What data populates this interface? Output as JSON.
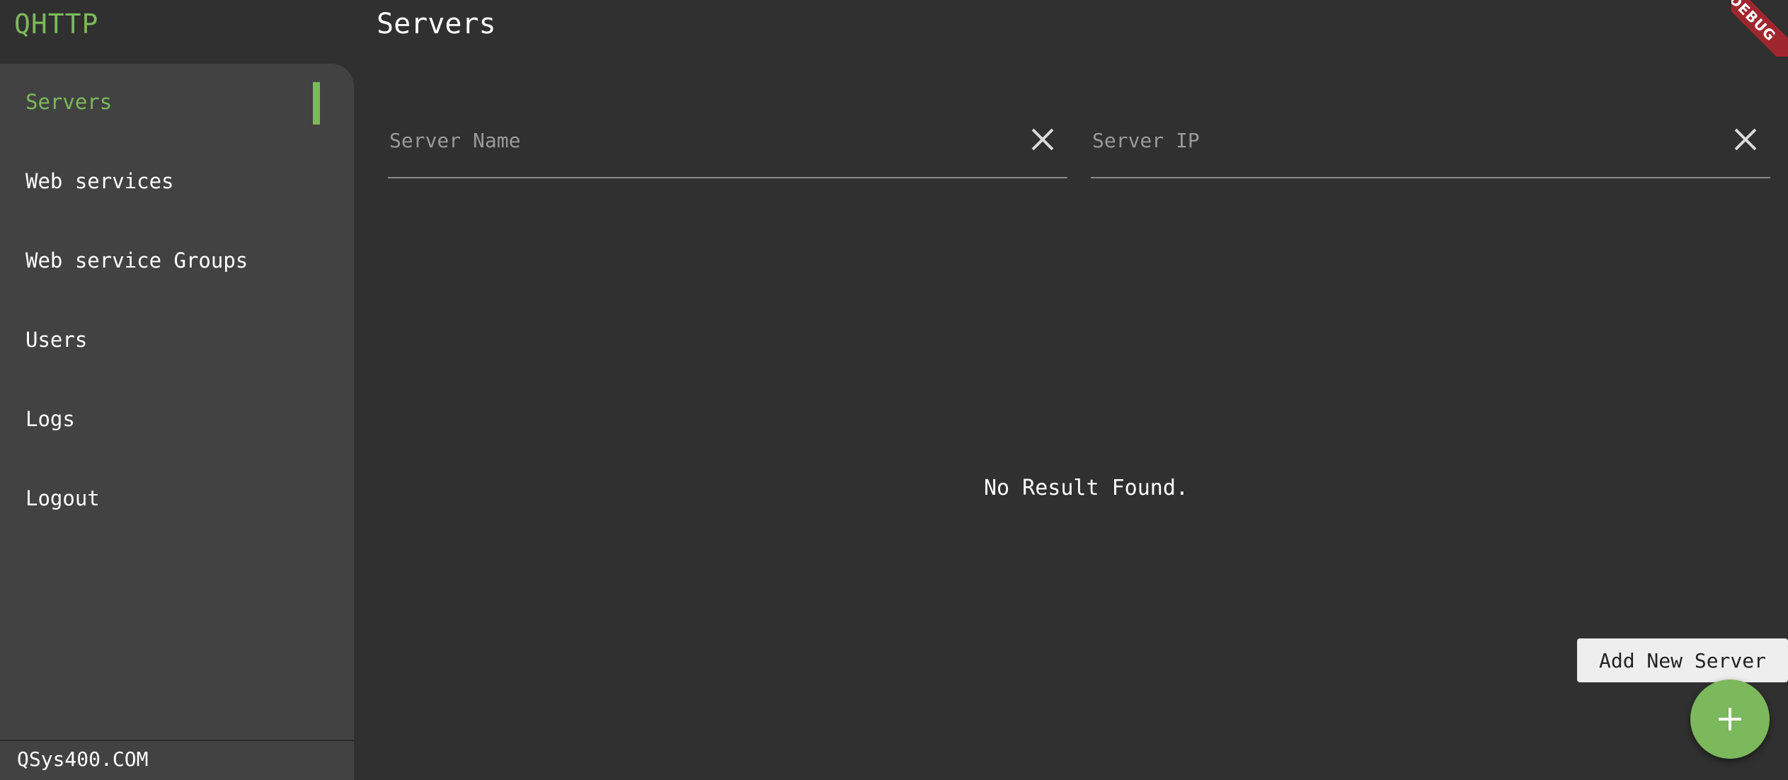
{
  "app": {
    "brand": "QHTTP",
    "debug_label": "DEBUG"
  },
  "header": {
    "title": "Servers"
  },
  "sidebar": {
    "items": [
      {
        "label": "Servers",
        "active": true
      },
      {
        "label": "Web services",
        "active": false
      },
      {
        "label": "Web service Groups",
        "active": false
      },
      {
        "label": "Users",
        "active": false
      },
      {
        "label": "Logs",
        "active": false
      },
      {
        "label": "Logout",
        "active": false
      }
    ],
    "footer": "QSys400.COM"
  },
  "filters": {
    "server_name": {
      "value": "",
      "placeholder": "Server Name"
    },
    "server_ip": {
      "value": "",
      "placeholder": "Server IP"
    }
  },
  "main": {
    "empty_message": "No Result Found."
  },
  "fab": {
    "tooltip": "Add New Server",
    "icon": "plus-icon"
  },
  "colors": {
    "accent": "#7cb85c",
    "background": "#303030",
    "sidebar": "#424242",
    "debug_banner": "#a0262e"
  }
}
